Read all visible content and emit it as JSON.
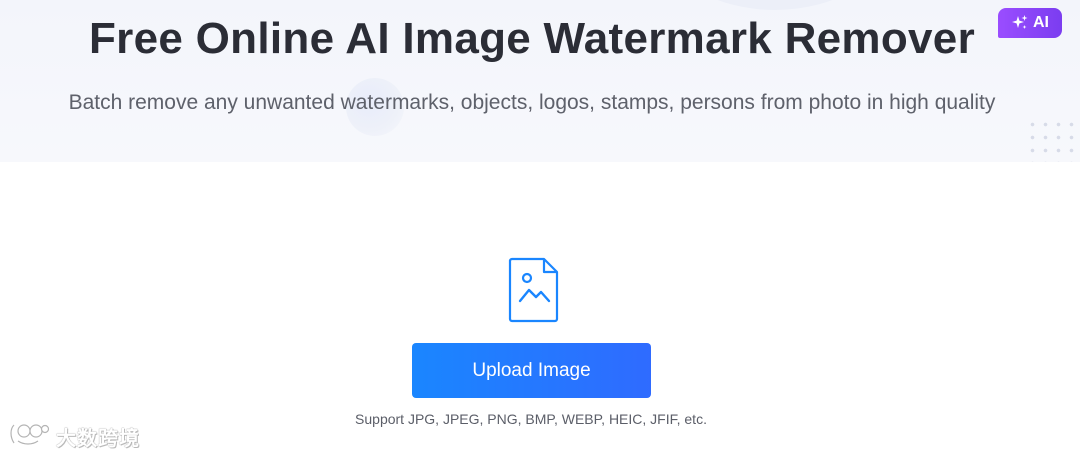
{
  "hero": {
    "title": "Free Online AI Image Watermark Remover",
    "badge": "AI",
    "badge_icon": "sparkle-icon",
    "subtitle": "Batch remove any unwanted watermarks, objects, logos, stamps, persons from photo in high quality"
  },
  "upload": {
    "icon": "image-file-icon",
    "button_label": "Upload Image",
    "support_text": "Support JPG, JPEG, PNG, BMP, WEBP, HEIC, JFIF, etc."
  },
  "watermark": {
    "text": "大数跨境",
    "icon": "logo-icon"
  },
  "colors": {
    "primary": "#1a86ff",
    "badge": "#8b45f5",
    "title": "#2b2d36",
    "hero_bg": "#f3f5fb"
  }
}
